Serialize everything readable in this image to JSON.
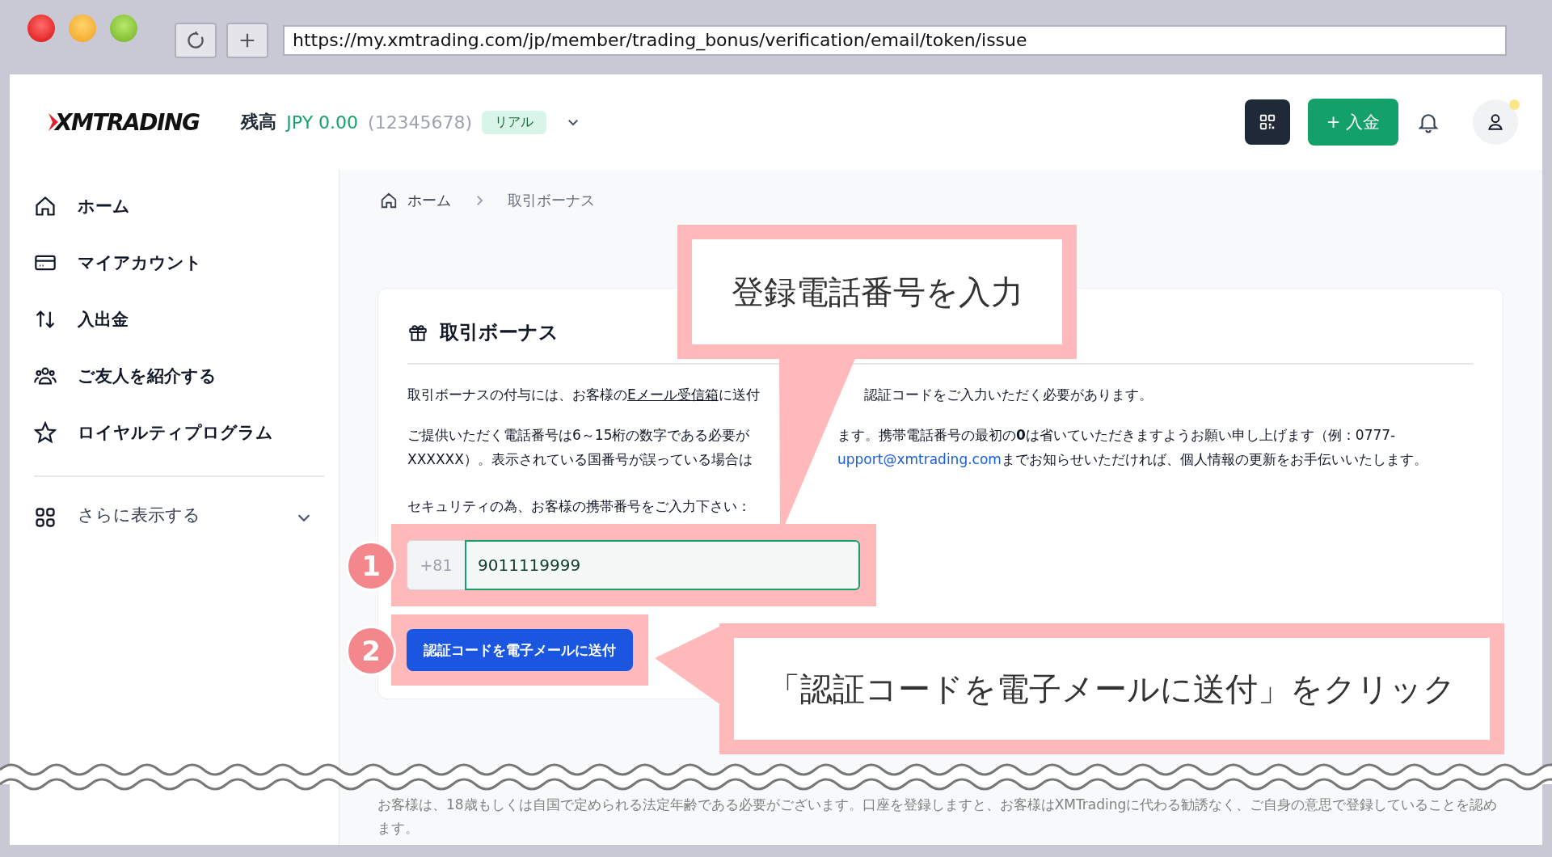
{
  "browser": {
    "url": "https://my.xmtrading.com/jp/member/trading_bonus/verification/email/token/issue"
  },
  "header": {
    "logo": "XMTRADING",
    "balance_label": "残高",
    "balance": "JPY 0.00",
    "account": "(12345678)",
    "account_type": "リアル",
    "deposit_button": "+ 入金"
  },
  "sidebar": {
    "items": [
      {
        "label": "ホーム"
      },
      {
        "label": "マイアカウント"
      },
      {
        "label": "入出金"
      },
      {
        "label": "ご友人を紹介する"
      },
      {
        "label": "ロイヤルティプログラム"
      }
    ],
    "more": {
      "label": "さらに表示する",
      "expanded": false
    }
  },
  "breadcrumb": [
    "ホーム",
    "取引ボーナス"
  ],
  "card": {
    "title": "取引ボーナス",
    "paragraphs": [
      {
        "lines": [
          {
            "before": [
              {
                "kind": "text",
                "text": "取引ボーナスの付与には、お客様の"
              },
              {
                "kind": "link",
                "text": "Eメール受信箱"
              },
              {
                "kind": "text",
                "text": "に送付"
              }
            ],
            "after": [
              {
                "kind": "text",
                "text": "認証コードをご入力いただく必要があります。"
              }
            ]
          }
        ]
      },
      {
        "lines": [
          {
            "before": [
              {
                "kind": "text",
                "text": "ご提供いただく電話番号は6～15桁の数字である必要が"
              }
            ],
            "after": [
              {
                "kind": "text",
                "text": "ます。携帯電話番号の最初の**0**は省いていただきますようお願い申し上げます（例：0777-"
              }
            ]
          },
          {
            "before": [
              {
                "kind": "text",
                "text": "XXXXXX）。表示されている国番号が誤っている場合は"
              }
            ],
            "after": [
              {
                "kind": "email",
                "text": "upport@xmtrading.com"
              },
              {
                "kind": "text",
                "text": "までお知らせいただければ、個人情報の更新をお手伝いいたします。"
              }
            ]
          }
        ]
      }
    ],
    "phone_label": "セキュリティの為、お客様の携帯番号をご入力下さい：",
    "country_code": "+81",
    "phone": "9011119999",
    "send_button": "認証コードを電子メールに送付"
  },
  "annotations": {
    "steps": [
      "1",
      "2"
    ],
    "callouts": [
      "登録電話番号を入力",
      "「認証コードを電子メールに送付」をクリック"
    ]
  },
  "footer": "お客様は、18歳もしくは自国で定められる法定年齢である必要がございます。口座を登録しますと、お客様はXMTradingに代わる勧誘なく、ご自身の意思で登録していることを認めます。"
}
